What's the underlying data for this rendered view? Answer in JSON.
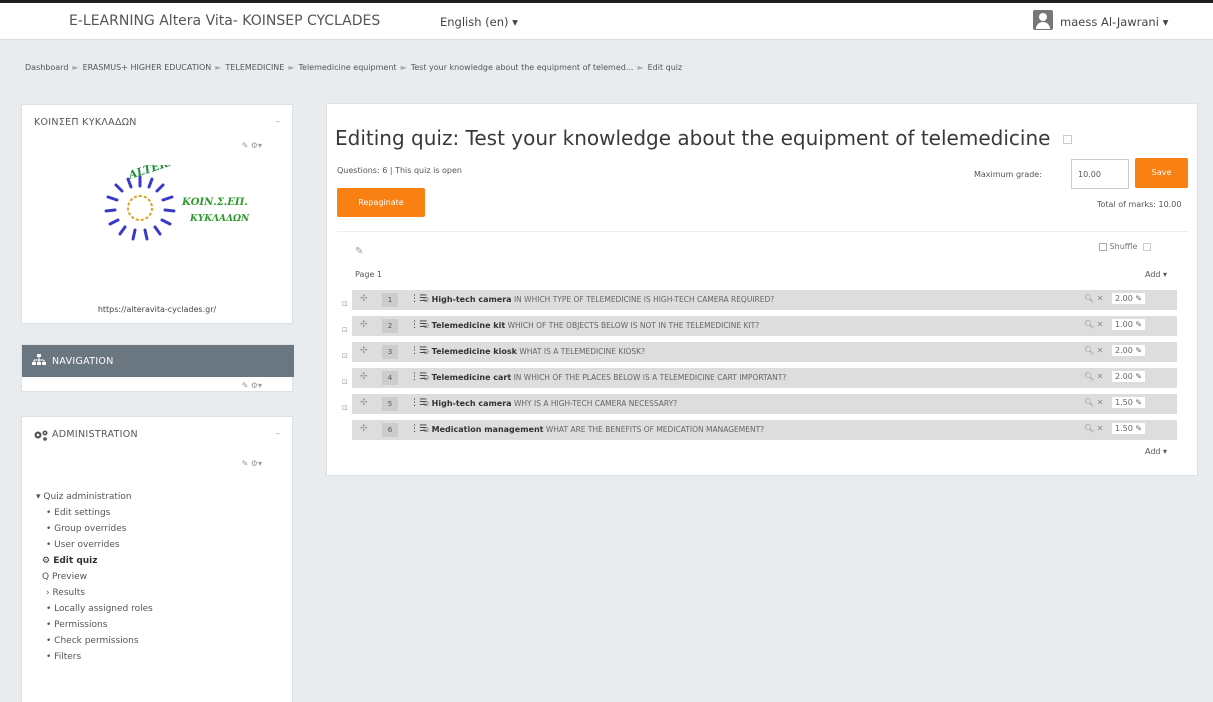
{
  "navbar": {
    "site_name": "E-LEARNING Altera Vita- KOINSEP CYCLADES",
    "language": "English (en) ▾",
    "user_name": "maess Al-Jawrani ▾"
  },
  "breadcrumb": [
    "Dashboard",
    "ERASMUS+ HIGHER EDUCATION",
    "TELEMEDICINE",
    "Telemedicine equipment",
    "Test your knowledge about the equipment of telemed...",
    "Edit quiz"
  ],
  "blocks": {
    "koinsep": {
      "title": "ΚΟΙΝΣΕΠ ΚΥΚΛΑΔΩΝ",
      "collapse": "–",
      "controls": "✎ ⚙▾",
      "logo_text_1": "ALTERA VITA",
      "logo_text_2": "ΚΟΙΝ.Σ.ΕΠ.",
      "logo_text_3": "ΚΥΚΛΑΔΩΝ",
      "url": "https://alteravita-cyclades.gr/"
    },
    "navigation": {
      "title": "NAVIGATION",
      "controls": "✎ ⚙▾"
    },
    "administration": {
      "title": "ADMINISTRATION",
      "collapse": "–",
      "controls": "✎ ⚙▾",
      "items": [
        "▾ Quiz administration",
        "• Edit settings",
        "• Group overrides",
        "• User overrides",
        "⚙ Edit quiz",
        "Q Preview",
        "› Results",
        "• Locally assigned roles",
        "• Permissions",
        "• Check permissions",
        "• Filters"
      ]
    }
  },
  "quiz": {
    "title": "Editing quiz: Test your knowledge about the equipment of telemedicine",
    "info": "Questions: 6 | This quiz is open",
    "repaginate": "Repaginate",
    "max_grade_label": "Maximum grade:",
    "max_grade_value": "10.00",
    "save": "Save",
    "total_marks": "Total of marks: 10.00",
    "shuffle": "Shuffle",
    "page_label": "Page 1",
    "add": "Add ▾",
    "questions": [
      {
        "num": "1",
        "name": "High-tech camera",
        "text": "IN WHICH TYPE OF TELEMEDICINE IS HIGH-TECH CAMERA REQUIRED?",
        "mark": "2.00"
      },
      {
        "num": "2",
        "name": "Telemedicine kit",
        "text": "WHICH OF THE OBJECTS BELOW IS NOT IN THE TELEMEDICINE KIT?",
        "mark": "1.00"
      },
      {
        "num": "3",
        "name": "Telemedicine kiosk",
        "text": "WHAT IS A TELEMEDICINE KIOSK?",
        "mark": "2.00"
      },
      {
        "num": "4",
        "name": "Telemedicine cart",
        "text": "IN WHICH OF THE PLACES BELOW IS A TELEMEDICINE CART IMPORTANT?",
        "mark": "2.00"
      },
      {
        "num": "5",
        "name": "High-tech camera",
        "text": "WHY IS A HIGH-TECH CAMERA NECESSARY?",
        "mark": "1.50"
      },
      {
        "num": "6",
        "name": "Medication management",
        "text": "WHAT ARE THE BENEFITS OF MEDICATION MANAGEMENT?",
        "mark": "1.50"
      }
    ]
  }
}
